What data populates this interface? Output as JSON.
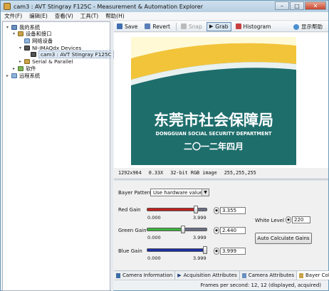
{
  "window": {
    "title": "cam3 : AVT Stingray F125C - Measurement & Automation Explorer"
  },
  "menu": [
    "文件(F)",
    "编辑(E)",
    "查看(V)",
    "工具(T)",
    "帮助(H)"
  ],
  "tree": {
    "my_system": "我的系统",
    "devices_interfaces": "设备和接口",
    "network_devices": "网络设备",
    "imaqdx": "NI-IMAQdx Devices",
    "camera": "cam3 : AVT Stingray F125C",
    "serial": "Serial & Parallel",
    "software": "软件",
    "remote": "远程系统"
  },
  "toolbar": {
    "save": "Save",
    "revert": "Revert",
    "snap": "Snap",
    "grab": "Grab",
    "histogram": "Histogram",
    "help": "显示帮助"
  },
  "image": {
    "title_cn": "东莞市社会保障局",
    "title_en": "DONGGUAN SOCIAL SECURITY DEPARTMENT",
    "date_cn": "二〇一二年四月"
  },
  "image_status": {
    "size": "1292x964",
    "zoom": "0.33X",
    "type": "32-bit RGB image",
    "pixel": "255,255,255"
  },
  "controls": {
    "bayer_pattern_label": "Bayer Pattern",
    "bayer_pattern_value": "Use hardware value",
    "red_gain_label": "Red Gain",
    "green_gain_label": "Green Gain",
    "blue_gain_label": "Blue Gain",
    "min": "0.000",
    "max": "3.999",
    "red_gain_value": "3.355",
    "green_gain_value": "2.440",
    "blue_gain_value": "3.999",
    "red_gain_fraction": 0.839,
    "green_gain_fraction": 0.61,
    "blue_gain_fraction": 1.0,
    "white_level_label": "White Level",
    "white_level_value": "220",
    "auto_button": "Auto Calculate Gains",
    "red_color": "#c0201e",
    "green_color": "#3db43d",
    "blue_color": "#1a2fa8"
  },
  "tabs": [
    "Camera Information",
    "Acquisition Attributes",
    "Camera Attributes",
    "Bayer Color"
  ],
  "status": {
    "fps": "Frames per second: 12, 12 (displayed, acquired)"
  }
}
